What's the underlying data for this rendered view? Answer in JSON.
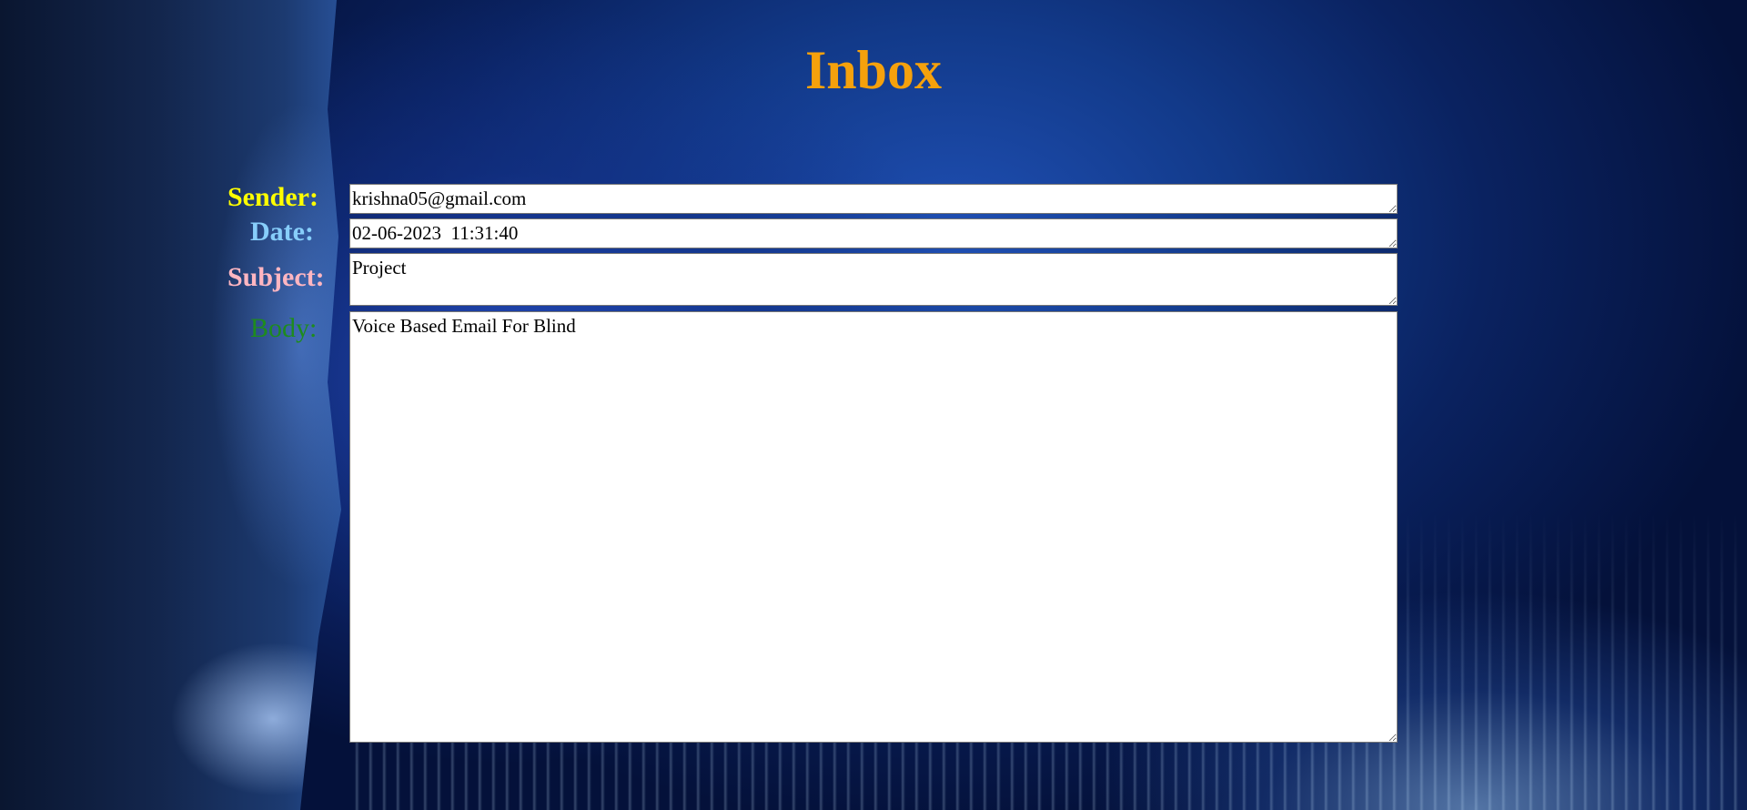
{
  "page": {
    "title": "Inbox"
  },
  "fields": {
    "sender": {
      "label": "Sender:",
      "value": "krishna05@gmail.com"
    },
    "date": {
      "label": "Date:",
      "value": "02-06-2023  11:31:40"
    },
    "subject": {
      "label": "Subject:",
      "value": "Project"
    },
    "body": {
      "label": "Body:",
      "value": "Voice Based Email For Blind"
    }
  },
  "colors": {
    "title": "#f5a10c",
    "sender_label": "#ffff00",
    "date_label": "#87cefa",
    "subject_label": "#ffb6c1",
    "body_label": "#1e8b1e",
    "background_accent": "#123a8a"
  }
}
